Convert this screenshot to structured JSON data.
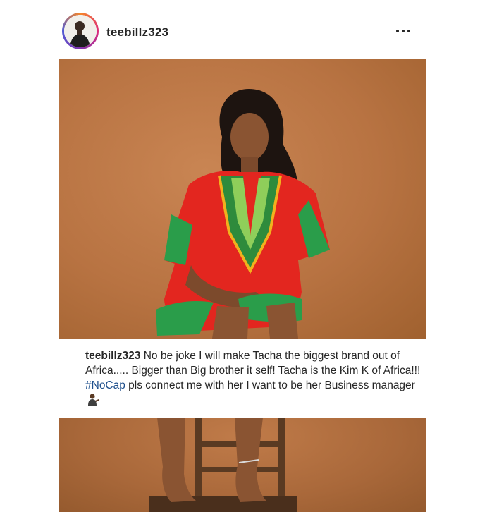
{
  "post": {
    "username": "teebillz323",
    "more_icon": "more-horizontal-icon"
  },
  "caption": {
    "username": "teebillz323",
    "text_1": " No be joke I will make Tacha the biggest brand out of Africa..... Bigger than Big brother it self! Tacha is the Kim K of Africa!!! ",
    "hashtag": "#NoCap",
    "text_2": " pls connect me with her I want to be her Business manager",
    "emoji_icon": "person-tipping-hand-icon"
  },
  "colors": {
    "background": "#ffffff",
    "text": "#262626",
    "hashtag": "#1e4f8c",
    "photo_backdrop": "#b87342"
  }
}
